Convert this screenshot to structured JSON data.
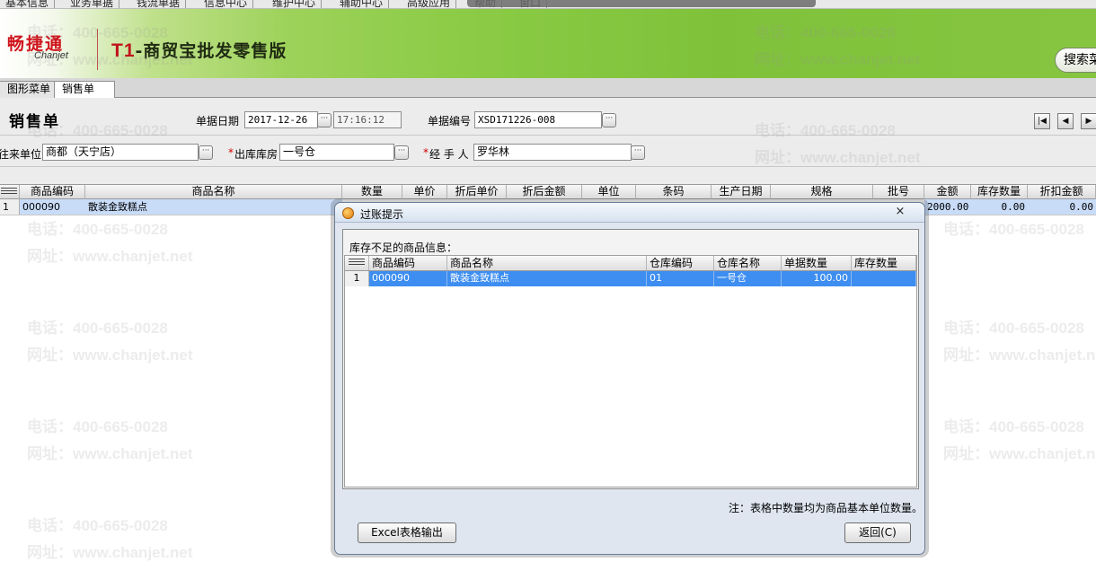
{
  "menu": {
    "items": [
      "基本信息",
      "业务单据",
      "钱流单据",
      "信息中心",
      "维护中心",
      "辅助中心",
      "高级应用",
      "帮助",
      "窗口"
    ]
  },
  "banner": {
    "brand_cn": "畅捷通",
    "brand_en": "Chanjet",
    "product_title_t1": "T1",
    "product_title_rest": "-商贸宝批发零售版",
    "search_label": "搜索菜"
  },
  "tabs": [
    {
      "label": "图形菜单",
      "active": false
    },
    {
      "label": "销售单",
      "active": true
    }
  ],
  "form": {
    "title": "销售单",
    "date_label": "单据日期",
    "date_value": "2017-12-26",
    "time_value": "17:16:12",
    "number_label": "单据编号",
    "number_value": "XSD171226-008",
    "customer_label": "往来单位",
    "customer_value": "商都（天宁店）",
    "warehouse_required": "*",
    "warehouse_label": "出库库房",
    "warehouse_value": "一号仓",
    "handler_required": "*",
    "handler_label": "经 手 人",
    "handler_value": "罗华林"
  },
  "nav": {
    "first": "|◀",
    "prev": "◀",
    "next": "▶"
  },
  "grid": {
    "columns": [
      "商品编码",
      "商品名称",
      "数量",
      "单价",
      "折后单价",
      "折后金额",
      "单位",
      "条码",
      "生产日期",
      "规格",
      "批号",
      "金额",
      "库存数量",
      "折扣金额"
    ],
    "rows": [
      {
        "rownum": "1",
        "code": "000090",
        "name": "散装金致糕点",
        "amount": "2000.00",
        "stock_qty": "0.00",
        "discount_amount": "0.00"
      }
    ]
  },
  "watermark": {
    "phone": "电话：400-665-0028",
    "site": "网址：www.chanjet.net"
  },
  "dialog": {
    "title": "过账提示",
    "close": "×",
    "panel_label": "库存不足的商品信息：",
    "columns": [
      "商品编码",
      "商品名称",
      "仓库编码",
      "仓库名称",
      "单据数量",
      "库存数量"
    ],
    "rows": [
      {
        "rownum": "1",
        "code": "000090",
        "name": "散装金致糕点",
        "wh_code": "01",
        "wh_name": "一号仓",
        "doc_qty": "100.00",
        "stock_qty": ""
      }
    ],
    "note": "注：表格中数量均为商品基本单位数量。",
    "excel_button": "Excel表格输出",
    "back_button": "返回(C)"
  }
}
